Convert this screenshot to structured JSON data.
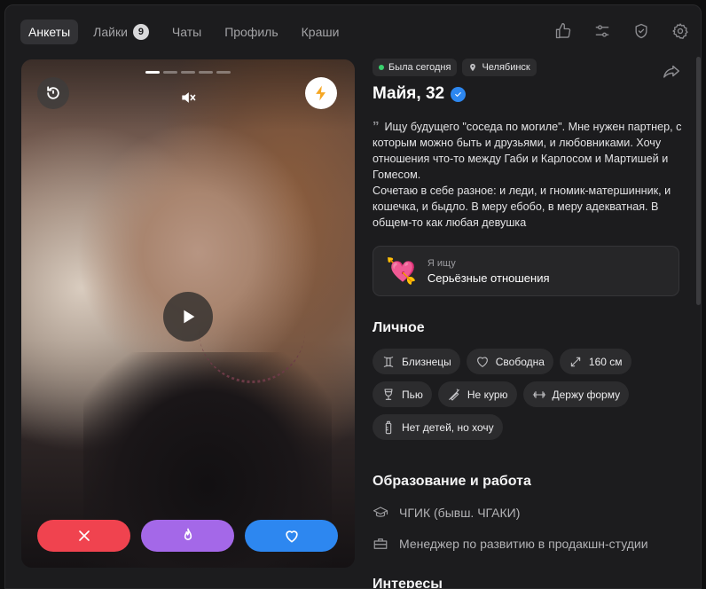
{
  "tabs": [
    {
      "label": "Анкеты"
    },
    {
      "label": "Лайки",
      "count": "9"
    },
    {
      "label": "Чаты"
    },
    {
      "label": "Профиль"
    },
    {
      "label": "Краши"
    }
  ],
  "top_icons": [
    "thumbs-up-icon",
    "sliders-icon",
    "shield-check-icon",
    "gear-icon"
  ],
  "photo": {
    "slides_total": 5,
    "slide_active": 1
  },
  "profile": {
    "status": "Была сегодня",
    "city": "Челябинск",
    "name": "Майя, 32",
    "bio": "Ищу будущего \"соседа по могиле\". Мне нужен партнер, с которым можно быть и друзьями, и любовниками. Хочу отношения что-то между Габи и Карлосом и Мартишей и Гомесом.\nСочетаю в себе разное: и леди, и гномик-матершинник, и кошечка, и быдло. В меру ебобо, в меру адекватная. В общем-то как любая девушка",
    "looking_label": "Я ищу",
    "looking_value": "Серьёзные отношения"
  },
  "personal": {
    "title": "Личное",
    "tags": [
      {
        "icon": "gemini-icon",
        "label": "Близнецы"
      },
      {
        "icon": "heart-outline-icon",
        "label": "Свободна"
      },
      {
        "icon": "height-arrows-icon",
        "label": "160 см"
      },
      {
        "icon": "wine-glass-icon",
        "label": "Пью"
      },
      {
        "icon": "no-smoking-icon",
        "label": "Не курю"
      },
      {
        "icon": "dumbbell-icon",
        "label": "Держу форму"
      },
      {
        "icon": "baby-bottle-icon",
        "label": "Нет детей, но хочу"
      }
    ]
  },
  "education": {
    "title": "Образование и работа",
    "school": "ЧГИК (бывш. ЧГАКИ)",
    "job": "Менеджер по развитию в продакшн-студии"
  },
  "interests": {
    "title": "Интересы"
  },
  "colors": {
    "accent_blue": "#2d87f0",
    "dislike_red": "#f0434f",
    "superlike_purple": "#a468e8",
    "online_green": "#3ad16d"
  }
}
